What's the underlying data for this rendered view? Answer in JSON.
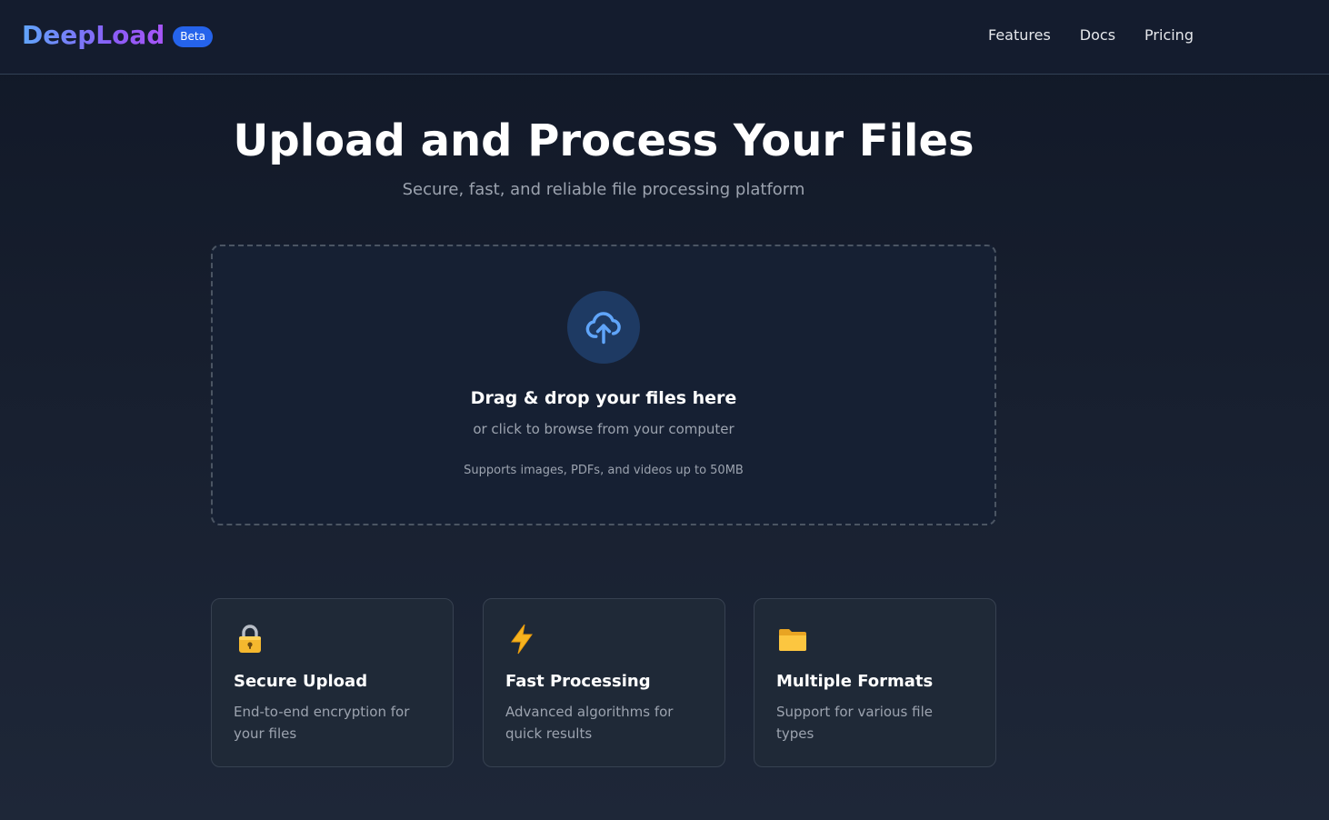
{
  "header": {
    "logo": "DeepLoad",
    "badge": "Beta",
    "nav": [
      "Features",
      "Docs",
      "Pricing"
    ]
  },
  "hero": {
    "title": "Upload and Process Your Files",
    "subtitle": "Secure, fast, and reliable file processing platform"
  },
  "dropzone": {
    "icon": "cloud-upload-icon",
    "title": "Drag & drop your files here",
    "subtitle": "or click to browse from your computer",
    "note": "Supports images, PDFs, and videos up to 50MB"
  },
  "features": [
    {
      "icon": "lock-icon",
      "title": "Secure Upload",
      "description": "End-to-end encryption for your files"
    },
    {
      "icon": "lightning-icon",
      "title": "Fast Processing",
      "description": "Advanced algorithms for quick results"
    },
    {
      "icon": "folder-icon",
      "title": "Multiple Formats",
      "description": "Support for various file types"
    }
  ],
  "colors": {
    "background": "#111827",
    "accent": "#2563eb",
    "upload_icon": "#60a5fa",
    "card": "#1f2937"
  }
}
